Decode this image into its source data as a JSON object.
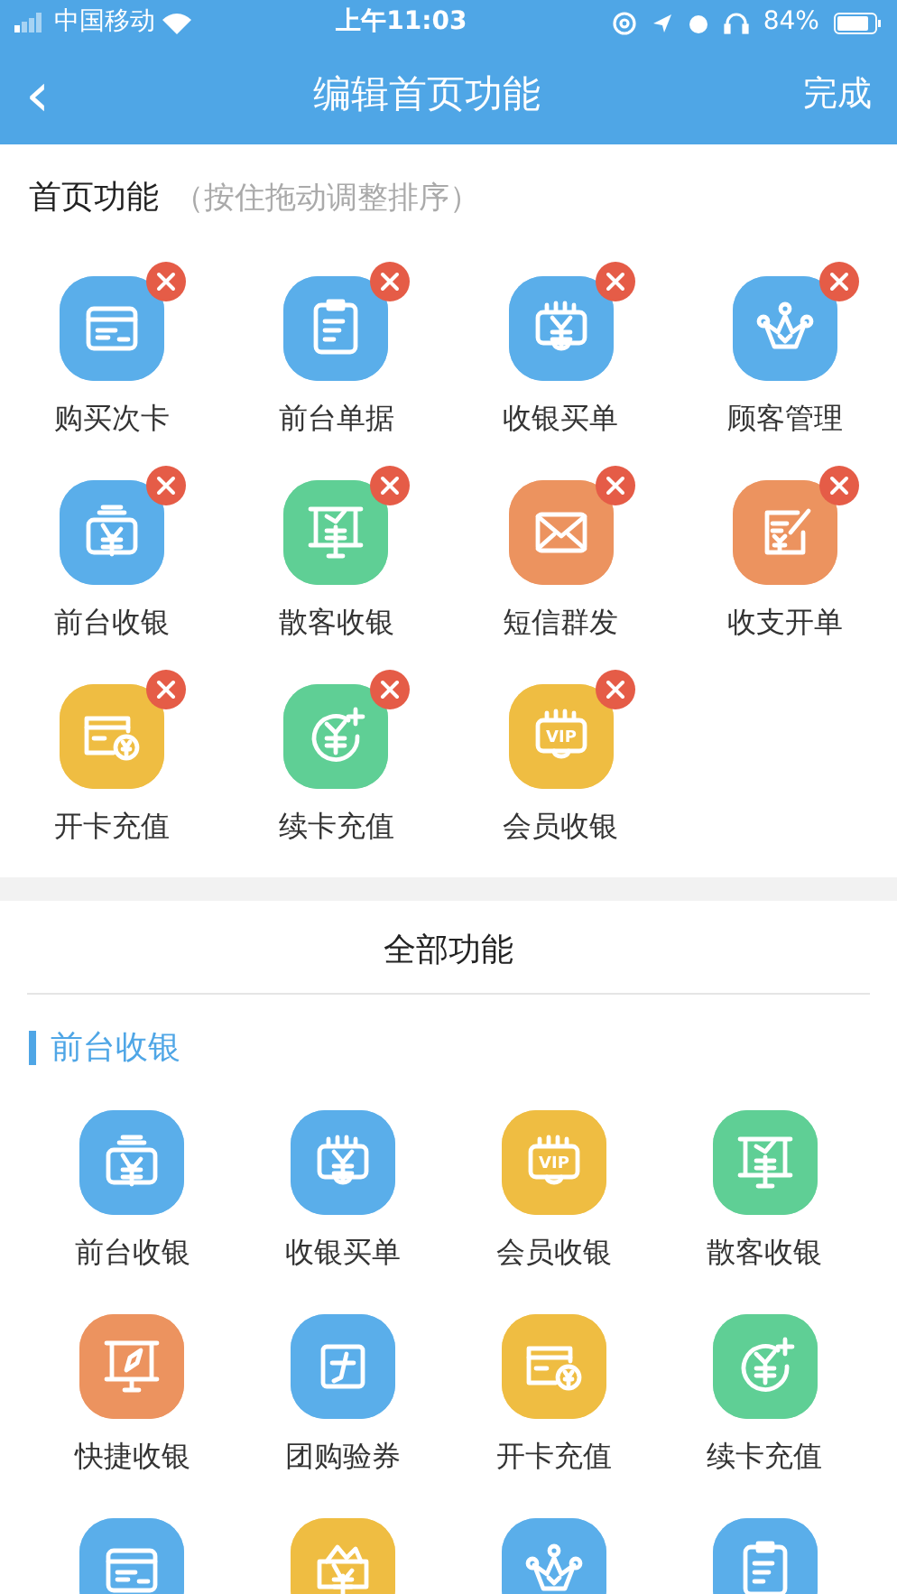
{
  "status_bar": {
    "carrier": "中国移动",
    "time": "上午11:03",
    "battery": "84%"
  },
  "nav_bar": {
    "back": "‹",
    "title": "编辑首页功能",
    "action": "完成"
  },
  "home_section": {
    "title": "首页功能",
    "hint": "（按住拖动调整排序）",
    "items": [
      {
        "label": "购买次卡",
        "kind": "card",
        "color": "#5aaeea",
        "removable": true
      },
      {
        "label": "前台单据",
        "kind": "clipboard",
        "color": "#5aaeea",
        "removable": true
      },
      {
        "label": "收银买单",
        "kind": "register",
        "color": "#5aaeea",
        "removable": true
      },
      {
        "label": "顾客管理",
        "kind": "crown",
        "color": "#5aaeea",
        "removable": true
      },
      {
        "label": "前台收银",
        "kind": "wallet",
        "color": "#5aaeea",
        "removable": true
      },
      {
        "label": "散客收银",
        "kind": "screen",
        "color": "#5fcf95",
        "removable": true
      },
      {
        "label": "短信群发",
        "kind": "mail",
        "color": "#ec935f",
        "removable": true
      },
      {
        "label": "收支开单",
        "kind": "bill",
        "color": "#ec935f",
        "removable": true
      },
      {
        "label": "开卡充值",
        "kind": "cardcoin",
        "color": "#efbd42",
        "removable": true
      },
      {
        "label": "续卡充值",
        "kind": "yenplus",
        "color": "#5fcf95",
        "removable": true
      },
      {
        "label": "会员收银",
        "kind": "vip",
        "glyph_text": "VIP",
        "color": "#efbd42",
        "removable": true
      }
    ]
  },
  "all_section": {
    "title": "全部功能",
    "group": "前台收银",
    "items": [
      {
        "label": "前台收银",
        "kind": "wallet",
        "color": "#5aaeea"
      },
      {
        "label": "收银买单",
        "kind": "register",
        "color": "#5aaeea"
      },
      {
        "label": "会员收银",
        "kind": "vip",
        "glyph_text": "VIP",
        "color": "#efbd42"
      },
      {
        "label": "散客收银",
        "kind": "screen",
        "color": "#5fcf95"
      },
      {
        "label": "快捷收银",
        "kind": "screenpen",
        "color": "#ec935f"
      },
      {
        "label": "团购验券",
        "kind": "square",
        "color": "#5aaeea"
      },
      {
        "label": "开卡充值",
        "kind": "cardcoin",
        "color": "#efbd42"
      },
      {
        "label": "续卡充值",
        "kind": "yenplus",
        "color": "#5fcf95"
      },
      {
        "kind": "card",
        "color": "#5aaeea"
      },
      {
        "kind": "gift",
        "color": "#efbd42"
      },
      {
        "kind": "crown",
        "color": "#5aaeea"
      },
      {
        "kind": "clipboard",
        "color": "#5aaeea"
      }
    ]
  }
}
